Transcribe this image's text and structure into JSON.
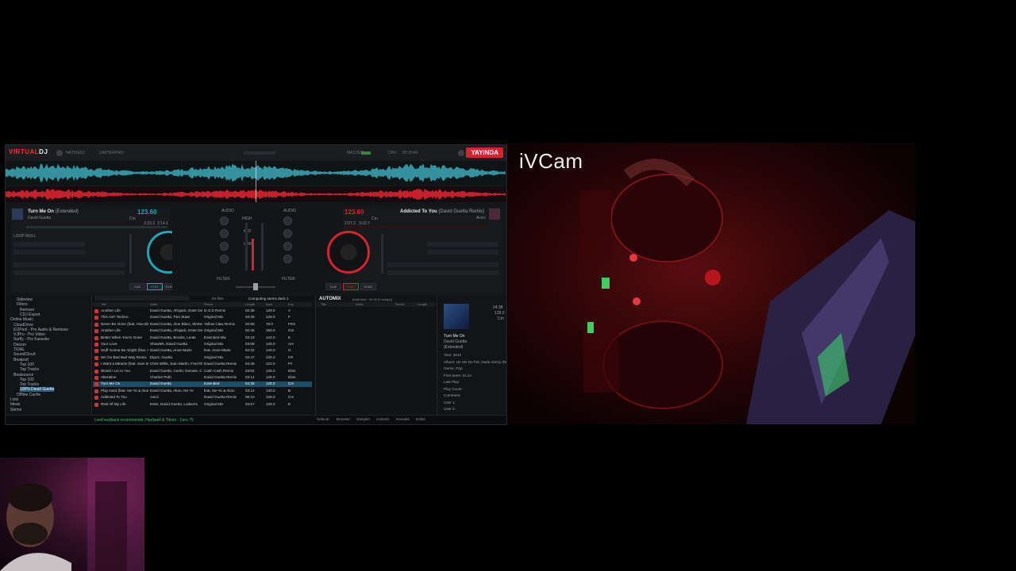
{
  "app": {
    "logo_left": "VIRTUAL",
    "logo_right": "DJ",
    "badge": "YAYINDA",
    "topbar_items": [
      "NATIVEDJ",
      "LIMITER",
      "PRO",
      "MASTER",
      "CPU",
      "02:20:49"
    ]
  },
  "deckA": {
    "title": "Turn Me On",
    "subtitle": "(Extended)",
    "artist": "David Guetta",
    "bpm": "123.60",
    "key": "Cm",
    "elapsed": "2:33.3",
    "remain": "2:14.1",
    "loop_label": "LOOP ROLL",
    "buttons": [
      "CUE",
      "PLAY",
      "SYNC"
    ],
    "color": "#1fa7b8"
  },
  "deckB": {
    "title": "Addicted To You",
    "subtitle": "(David Guetta Remix)",
    "artist": "Avicii",
    "bpm": "123.60",
    "key": "Cm",
    "elapsed": "2:07.2",
    "remain": "3:22.7",
    "buttons": [
      "CUE",
      "PLAY",
      "SYNC"
    ],
    "color": "#d8222f"
  },
  "mixer": {
    "labels": [
      "AUDIO",
      "GAIN",
      "HIGH",
      "MID",
      "LOW",
      "FILTER",
      "FILTER"
    ]
  },
  "browser": {
    "tree": [
      {
        "label": "Sideview",
        "sel": false
      },
      {
        "label": "Filters",
        "sel": false
      },
      {
        "label": "Remixer",
        "sel": false
      },
      {
        "label": "CDJ Export",
        "sel": false
      },
      {
        "label": "Online Music",
        "sel": false
      },
      {
        "label": "CloudDrive",
        "sel": false
      },
      {
        "label": "iDJPool - Pro Audio & Remixes",
        "sel": false
      },
      {
        "label": "VJPro - Pro Video",
        "sel": false
      },
      {
        "label": "Surfly - Pro Karaoke",
        "sel": false
      },
      {
        "label": "Deezer",
        "sel": false
      },
      {
        "label": "TIDAL",
        "sel": false
      },
      {
        "label": "SoundCloud",
        "sel": false
      },
      {
        "label": "Beatport",
        "sel": false
      },
      {
        "label": "Top 100",
        "sel": false
      },
      {
        "label": "Top Tracks",
        "sel": false
      },
      {
        "label": "Beatsource",
        "sel": false
      },
      {
        "label": "Top 100",
        "sel": false
      },
      {
        "label": "Top Tracks",
        "sel": false
      },
      {
        "label": "100% David Guetta",
        "sel": true
      },
      {
        "label": "Offline Cache",
        "sel": false
      },
      {
        "label": "Lists",
        "sel": false
      },
      {
        "label": "Ideas",
        "sel": false
      },
      {
        "label": "Stems",
        "sel": false
      }
    ],
    "search_count": "53 files",
    "status": "Computing stems deck 1",
    "columns": [
      "Title",
      "Artist",
      "Remix",
      "Length",
      "Bpm",
      "Key"
    ],
    "rows": [
      [
        "Another Life",
        "David Guetta, Afrojack, Ester Dean",
        "D.O.D Remix",
        "02:38",
        "128.0",
        "A"
      ],
      [
        "This Ain't Techno",
        "David Guetta, Tom Staar",
        "Original Mix",
        "03:39",
        "128.0",
        "F"
      ],
      [
        "Never Be Alone (feat. Aloe Blacc)",
        "David Guetta, Aloe Blacc, Morten",
        "Yellow Claw Remix",
        "02:55",
        "78.0",
        "F#m"
      ],
      [
        "Another Life",
        "David Guetta, Afrojack, Ester Dean",
        "Original Mix",
        "02:45",
        "150.0",
        "Gm"
      ],
      [
        "Better When You're Gone",
        "David Guetta, Brooks, Loote",
        "Extended Mix",
        "03:19",
        "124.0",
        "E"
      ],
      [
        "Your Love",
        "Showtek, David Guetta",
        "Original Mix",
        "03:08",
        "125.0",
        "Am"
      ],
      [
        "Stuff Gonna Be Alright (feat. Anne-Marie)",
        "David Guetta, Anne-Marie",
        "feat. Anne-Marie",
        "04:32",
        "128.0",
        "G"
      ],
      [
        "We Go Bad Bad Way Remix",
        "Dipoz, Guetta",
        "Original Mix",
        "02:47",
        "125.0",
        "G#"
      ],
      [
        "I Want a Miracle (feat. Sam Martin)",
        "Chris Willis, Sam Martin, Fred Rister",
        "David Guetta Remix",
        "04:48",
        "122.0",
        "F#"
      ],
      [
        "Would I Lie to You",
        "David Guetta, Cedric Gervais, Chris",
        "Cash Cash Remix",
        "03:02",
        "125.0",
        "Ebm"
      ],
      [
        "Alteration",
        "Charlee Puth",
        "David Guetta Remix",
        "03:14",
        "128.0",
        "Ebm"
      ],
      [
        "Turn Me On",
        "David Guetta",
        "Extended",
        "04:38",
        "128.0",
        "Cm"
      ],
      [
        "Play Hard (feat. Ne-Yo & Akon)",
        "David Guetta, Akon, Ne-Yo",
        "feat. Ne-Yo & Akon",
        "03:12",
        "130.0",
        "B"
      ],
      [
        "Addicted To You",
        "Avicii",
        "David Guetta Remix",
        "05:10",
        "128.0",
        "Cm"
      ],
      [
        "Rest Of My Life",
        "Ester, David Guetta, Ludacris",
        "Original Mix",
        "03:57",
        "128.0",
        "D"
      ]
    ],
    "selected_row": 11,
    "automix_label": "AUTOMIX",
    "automix_sub": "(total time : 00:00 (0 songs))",
    "automix_columns": [
      "Title",
      "Artist",
      "Remix",
      "Length"
    ],
    "statusbar_text": "LiveFeedback recommends: Hardwell & Tiësto - Zero 76",
    "info": {
      "title": "Turn Me On",
      "artist": "David Guetta",
      "remix": "(Extended)",
      "length": "04:38",
      "bpm": "128.0",
      "key": "Cm",
      "fields": [
        "Year: 2012",
        "Album: Un Ver De Fer, Nada Vonzy (Remix)",
        "Genre: Pop",
        "First Seen: 01:44",
        "Last Play:",
        "Play Count:",
        "Comment:",
        "User 1:",
        "User 2:"
      ]
    },
    "tabs": [
      "Sidecar",
      "Browser",
      "Sampler",
      "Automix",
      "Karaoke",
      "Editor"
    ]
  },
  "camera": {
    "label": "iVCam"
  }
}
